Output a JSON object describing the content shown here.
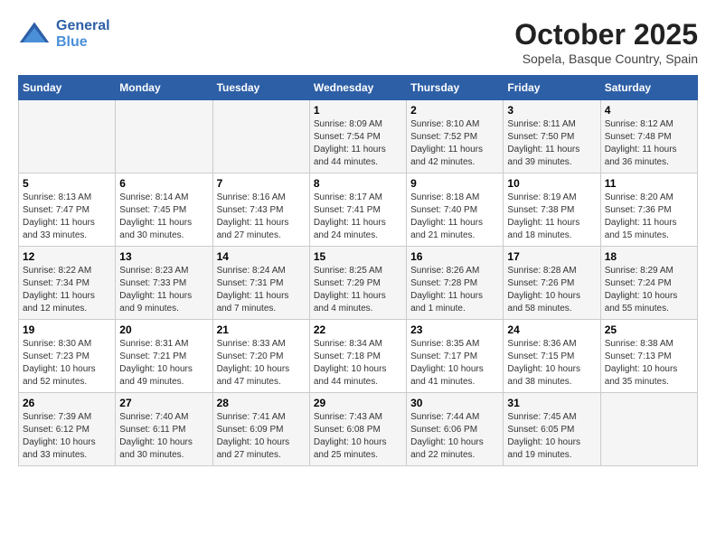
{
  "header": {
    "logo_general": "General",
    "logo_blue": "Blue",
    "month": "October 2025",
    "location": "Sopela, Basque Country, Spain"
  },
  "weekdays": [
    "Sunday",
    "Monday",
    "Tuesday",
    "Wednesday",
    "Thursday",
    "Friday",
    "Saturday"
  ],
  "weeks": [
    [
      {
        "day": "",
        "info": ""
      },
      {
        "day": "",
        "info": ""
      },
      {
        "day": "",
        "info": ""
      },
      {
        "day": "1",
        "info": "Sunrise: 8:09 AM\nSunset: 7:54 PM\nDaylight: 11 hours and 44 minutes."
      },
      {
        "day": "2",
        "info": "Sunrise: 8:10 AM\nSunset: 7:52 PM\nDaylight: 11 hours and 42 minutes."
      },
      {
        "day": "3",
        "info": "Sunrise: 8:11 AM\nSunset: 7:50 PM\nDaylight: 11 hours and 39 minutes."
      },
      {
        "day": "4",
        "info": "Sunrise: 8:12 AM\nSunset: 7:48 PM\nDaylight: 11 hours and 36 minutes."
      }
    ],
    [
      {
        "day": "5",
        "info": "Sunrise: 8:13 AM\nSunset: 7:47 PM\nDaylight: 11 hours and 33 minutes."
      },
      {
        "day": "6",
        "info": "Sunrise: 8:14 AM\nSunset: 7:45 PM\nDaylight: 11 hours and 30 minutes."
      },
      {
        "day": "7",
        "info": "Sunrise: 8:16 AM\nSunset: 7:43 PM\nDaylight: 11 hours and 27 minutes."
      },
      {
        "day": "8",
        "info": "Sunrise: 8:17 AM\nSunset: 7:41 PM\nDaylight: 11 hours and 24 minutes."
      },
      {
        "day": "9",
        "info": "Sunrise: 8:18 AM\nSunset: 7:40 PM\nDaylight: 11 hours and 21 minutes."
      },
      {
        "day": "10",
        "info": "Sunrise: 8:19 AM\nSunset: 7:38 PM\nDaylight: 11 hours and 18 minutes."
      },
      {
        "day": "11",
        "info": "Sunrise: 8:20 AM\nSunset: 7:36 PM\nDaylight: 11 hours and 15 minutes."
      }
    ],
    [
      {
        "day": "12",
        "info": "Sunrise: 8:22 AM\nSunset: 7:34 PM\nDaylight: 11 hours and 12 minutes."
      },
      {
        "day": "13",
        "info": "Sunrise: 8:23 AM\nSunset: 7:33 PM\nDaylight: 11 hours and 9 minutes."
      },
      {
        "day": "14",
        "info": "Sunrise: 8:24 AM\nSunset: 7:31 PM\nDaylight: 11 hours and 7 minutes."
      },
      {
        "day": "15",
        "info": "Sunrise: 8:25 AM\nSunset: 7:29 PM\nDaylight: 11 hours and 4 minutes."
      },
      {
        "day": "16",
        "info": "Sunrise: 8:26 AM\nSunset: 7:28 PM\nDaylight: 11 hours and 1 minute."
      },
      {
        "day": "17",
        "info": "Sunrise: 8:28 AM\nSunset: 7:26 PM\nDaylight: 10 hours and 58 minutes."
      },
      {
        "day": "18",
        "info": "Sunrise: 8:29 AM\nSunset: 7:24 PM\nDaylight: 10 hours and 55 minutes."
      }
    ],
    [
      {
        "day": "19",
        "info": "Sunrise: 8:30 AM\nSunset: 7:23 PM\nDaylight: 10 hours and 52 minutes."
      },
      {
        "day": "20",
        "info": "Sunrise: 8:31 AM\nSunset: 7:21 PM\nDaylight: 10 hours and 49 minutes."
      },
      {
        "day": "21",
        "info": "Sunrise: 8:33 AM\nSunset: 7:20 PM\nDaylight: 10 hours and 47 minutes."
      },
      {
        "day": "22",
        "info": "Sunrise: 8:34 AM\nSunset: 7:18 PM\nDaylight: 10 hours and 44 minutes."
      },
      {
        "day": "23",
        "info": "Sunrise: 8:35 AM\nSunset: 7:17 PM\nDaylight: 10 hours and 41 minutes."
      },
      {
        "day": "24",
        "info": "Sunrise: 8:36 AM\nSunset: 7:15 PM\nDaylight: 10 hours and 38 minutes."
      },
      {
        "day": "25",
        "info": "Sunrise: 8:38 AM\nSunset: 7:13 PM\nDaylight: 10 hours and 35 minutes."
      }
    ],
    [
      {
        "day": "26",
        "info": "Sunrise: 7:39 AM\nSunset: 6:12 PM\nDaylight: 10 hours and 33 minutes."
      },
      {
        "day": "27",
        "info": "Sunrise: 7:40 AM\nSunset: 6:11 PM\nDaylight: 10 hours and 30 minutes."
      },
      {
        "day": "28",
        "info": "Sunrise: 7:41 AM\nSunset: 6:09 PM\nDaylight: 10 hours and 27 minutes."
      },
      {
        "day": "29",
        "info": "Sunrise: 7:43 AM\nSunset: 6:08 PM\nDaylight: 10 hours and 25 minutes."
      },
      {
        "day": "30",
        "info": "Sunrise: 7:44 AM\nSunset: 6:06 PM\nDaylight: 10 hours and 22 minutes."
      },
      {
        "day": "31",
        "info": "Sunrise: 7:45 AM\nSunset: 6:05 PM\nDaylight: 10 hours and 19 minutes."
      },
      {
        "day": "",
        "info": ""
      }
    ]
  ]
}
